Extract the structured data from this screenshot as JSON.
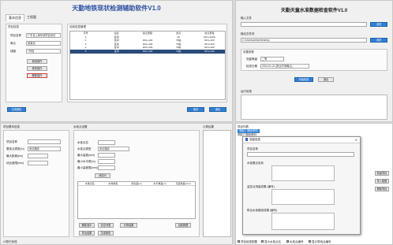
{
  "win1": {
    "title": "天勤地铁现状检测辅助软件V1.0",
    "tabs": [
      "基本信息",
      "工程量"
    ],
    "project_group": "项目信息",
    "fields": [
      {
        "label": "项目名称",
        "value": "广东省上库年线项目测试"
      },
      {
        "label": "单元",
        "value": "某某站"
      },
      {
        "label": "线路",
        "value": "7号线"
      }
    ],
    "buttons": [
      "新增操作",
      "修改操作",
      "删除操作"
    ],
    "list_group": "站段信息管理",
    "table_head": [
      "序号",
      "站名",
      "起点里程",
      "终点",
      "终点里程"
    ],
    "table_rows": [
      [
        "1",
        "区间",
        "",
        "1#",
        "DK1+1000"
      ],
      [
        "2",
        "区间",
        "DK1+100",
        "7#站",
        "DK1+100"
      ],
      [
        "3",
        "区间",
        "DK1+100",
        "7#站",
        "DK1+100"
      ],
      [
        "4",
        "区间",
        "DK1+100",
        "7#站",
        "DK1+100"
      ],
      [
        "5",
        "区间",
        "DK1+100",
        "7#站",
        "DK1+100"
      ]
    ],
    "bottom_left": "生成报告",
    "bottom_right": [
      "保存",
      "退出"
    ]
  },
  "win2": {
    "title": "天勤天童水准数据检查软件V1.0",
    "input_label": "输入文件",
    "browse": "浏览",
    "output_label": "输出文件夹",
    "output_value": "C:\\Users\\admin\\Desktop",
    "settings_group": "设置参数",
    "measure_label": "测量等级",
    "measure_value": "二等",
    "date_label": "检查日期",
    "date_value": "2024-01-01 (默认时间确认)",
    "start": "开始检查",
    "exit": "退出",
    "log_label": "运行信息"
  },
  "win3": {
    "left_group": "项目基本信息",
    "left_fields": [
      "项目名称",
      "基准点类型(m)",
      "最大距离(km)",
      "闭合差限(mm)"
    ],
    "type_value": "闭合路线",
    "mid_group": "水准点设置",
    "mid_fields": [
      "水准点名",
      "水准点类型",
      "最大高差(mm)",
      "最小水平角(m)",
      "最小高差限(mm)"
    ],
    "mid_type_value": "闭合路线",
    "add_btn": "添加行",
    "table_head": [
      "水准点名",
      "水准类型",
      "闭合差(m)",
      "水平角差(m)",
      "高差较差(mm)"
    ],
    "btns_row1": [
      "删除选中",
      "清空列表",
      "计算结果"
    ],
    "btns_row2": [
      "导出结果",
      "加载数据"
    ],
    "btn_export": "生成报告",
    "right_group": "计算结果",
    "status": "计算已完成"
  },
  "win4": {
    "tree_label": "项目列表",
    "tree_items": [
      "测区1 测段资料",
      "测区2 测段资料"
    ],
    "dialog_title": "测量信息",
    "dialog_field": "项目名称",
    "sections": [
      "水准基点坐标",
      "监控点测量成果 (编号)",
      "附合水准路线成果 (编号)"
    ],
    "side_btns": [
      "新建项目",
      "导入数据",
      "删除项目"
    ],
    "bottom_options": [
      "项目信息配置",
      "显示水准点名",
      "水准点编号",
      "显示导线点编号"
    ]
  }
}
